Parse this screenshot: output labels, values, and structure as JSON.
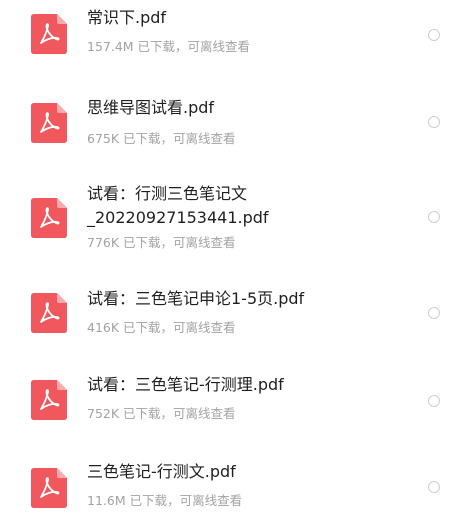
{
  "files": [
    {
      "name_line1": "常识下.pdf",
      "name_line2": "",
      "meta": "157.4M  已下载，可离线查看",
      "icon": "pdf-file-icon",
      "selected": false
    },
    {
      "name_line1": "思维导图试看.pdf",
      "name_line2": "",
      "meta": "675K  已下载，可离线查看",
      "icon": "pdf-file-icon",
      "selected": false
    },
    {
      "name_line1": "试看：行测三色笔记文",
      "name_line2": "_20220927153441.pdf",
      "meta": "776K  已下载，可离线查看",
      "icon": "pdf-file-icon",
      "selected": false
    },
    {
      "name_line1": "试看：三色笔记申论1-5页.pdf",
      "name_line2": "",
      "meta": "416K  已下载，可离线查看",
      "icon": "pdf-file-icon",
      "selected": false
    },
    {
      "name_line1": "试看：三色笔记-行测理.pdf",
      "name_line2": "",
      "meta": "752K  已下载，可离线查看",
      "icon": "pdf-file-icon",
      "selected": false
    },
    {
      "name_line1": "三色笔记-行测文.pdf",
      "name_line2": "",
      "meta": "11.6M  已下载，可离线查看",
      "icon": "pdf-file-icon",
      "selected": false
    }
  ],
  "colors": {
    "pdf_red": "#f0585e",
    "text_primary": "#1f1f1f",
    "text_secondary": "#a3a3a3",
    "radio_border": "#cfcfcf"
  }
}
